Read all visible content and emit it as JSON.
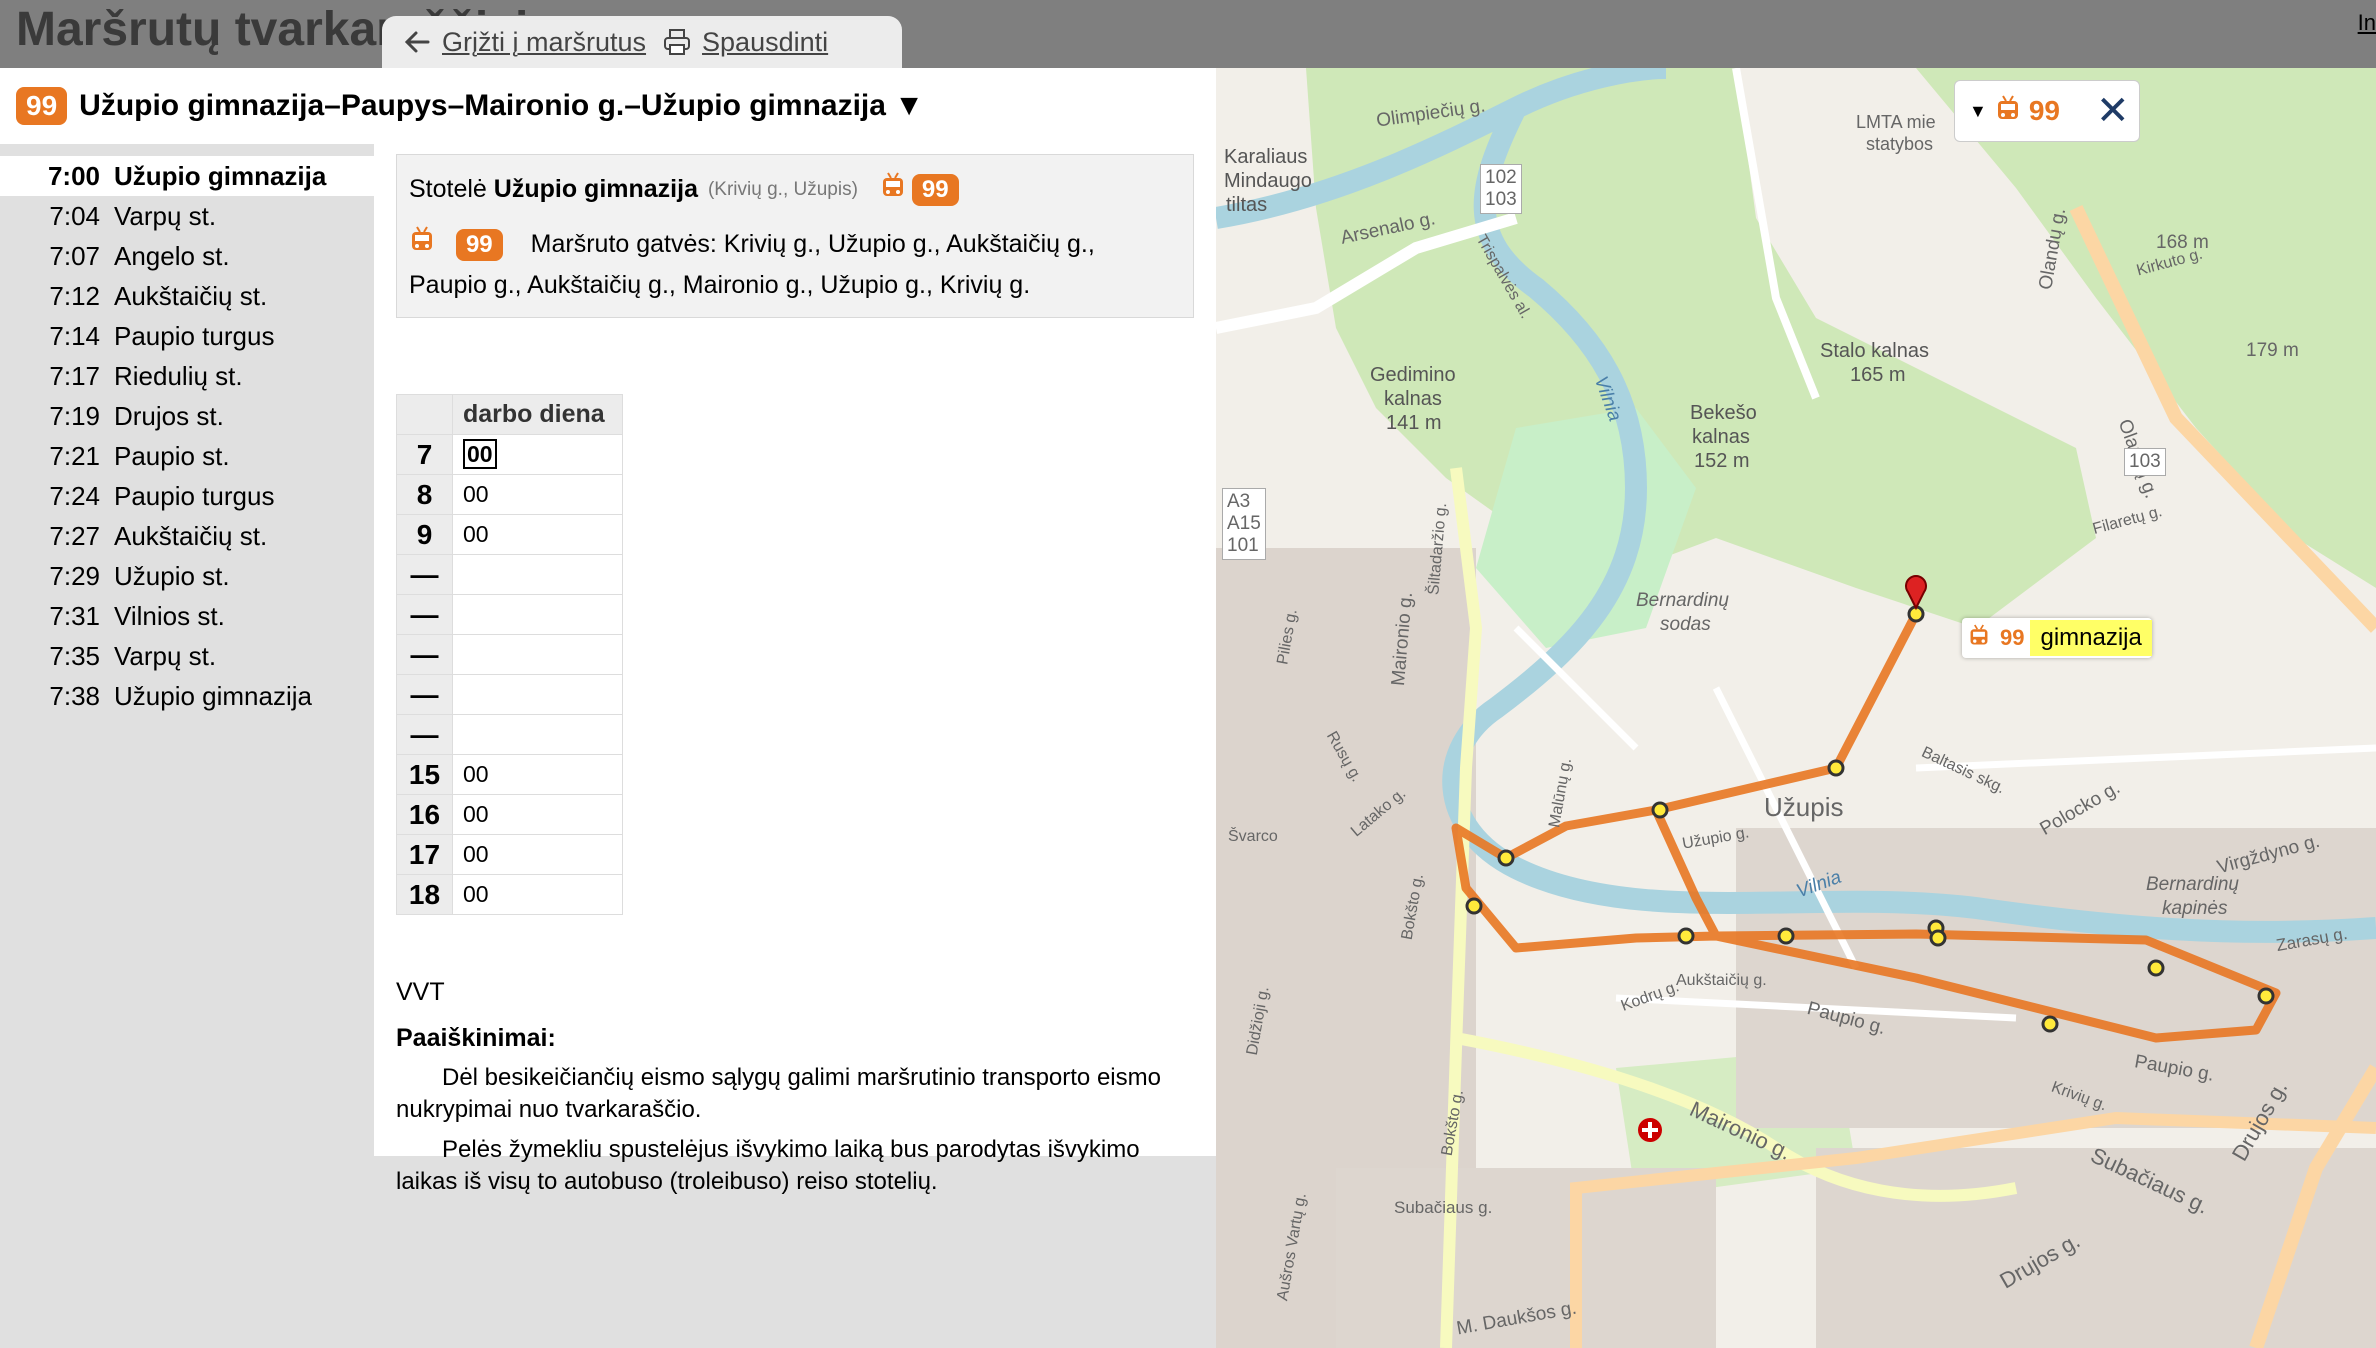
{
  "app": {
    "title": "Maršrutų tvarkaraščiai",
    "corner_link": "In"
  },
  "toolbar": {
    "back_label": "Grįžti į maršrutus",
    "print_label": "Spausdinti"
  },
  "route": {
    "number": "99",
    "title": "Užupio gimnazija–Paupys–Maironio g.–Užupio gimnazija ▼",
    "color": "#e87722"
  },
  "stops": [
    {
      "time": "7:00",
      "name": "Užupio gimnazija",
      "selected": true
    },
    {
      "time": "7:04",
      "name": "Varpų st."
    },
    {
      "time": "7:07",
      "name": "Angelo st."
    },
    {
      "time": "7:12",
      "name": "Aukštaičių st."
    },
    {
      "time": "7:14",
      "name": "Paupio turgus"
    },
    {
      "time": "7:17",
      "name": "Riedulių st."
    },
    {
      "time": "7:19",
      "name": "Drujos st."
    },
    {
      "time": "7:21",
      "name": "Paupio st."
    },
    {
      "time": "7:24",
      "name": "Paupio turgus"
    },
    {
      "time": "7:27",
      "name": "Aukštaičių st."
    },
    {
      "time": "7:29",
      "name": "Užupio st."
    },
    {
      "time": "7:31",
      "name": "Vilnios st."
    },
    {
      "time": "7:35",
      "name": "Varpų st."
    },
    {
      "time": "7:38",
      "name": "Užupio gimnazija"
    }
  ],
  "stop_info": {
    "prefix": "Stotelė",
    "name": "Užupio gimnazija",
    "details": "(Krivių g., Užupis)",
    "route_number": "99",
    "streets": "Maršruto gatvės: Krivių g., Užupio g., Aukštaičių g., Paupio g., Aukštaičių g., Maironio g., Užupio g., Krivių g."
  },
  "timetable": {
    "header": "darbo diena",
    "rows": [
      {
        "hour": "7",
        "minutes": "00",
        "selected": true
      },
      {
        "hour": "8",
        "minutes": "00"
      },
      {
        "hour": "9",
        "minutes": "00"
      },
      {
        "hour": "—",
        "minutes": ""
      },
      {
        "hour": "—",
        "minutes": ""
      },
      {
        "hour": "—",
        "minutes": ""
      },
      {
        "hour": "—",
        "minutes": ""
      },
      {
        "hour": "—",
        "minutes": ""
      },
      {
        "hour": "15",
        "minutes": "00"
      },
      {
        "hour": "16",
        "minutes": "00"
      },
      {
        "hour": "17",
        "minutes": "00"
      },
      {
        "hour": "18",
        "minutes": "00"
      }
    ]
  },
  "operator": "VVT",
  "explanations": {
    "heading": "Paaiškinimai:",
    "p1": "Dėl besikeičiančių eismo sąlygų galimi maršrutinio transporto eismo nukrypimai nuo tvarkaraščio.",
    "p2": "Pelės žymekliu spustelėjus išvykimo laiką bus parodytas išvykimo laikas iš visų to autobuso (troleibuso) reiso stotelių."
  },
  "map": {
    "control_route": "99",
    "tooltip_route": "99",
    "tooltip_name": "gimnazija",
    "labels": {
      "olimpieciu": "Olimpiečių g.",
      "karaliaus": "Karaliaus",
      "mindaugo": "Mindaugo",
      "tiltas": "tiltas",
      "arsenalo": "Arsenalo g.",
      "lmta1": "LMTA mie",
      "lmta2": "statybos",
      "gediminas1": "Gedimino",
      "gediminas2": "kalnas",
      "gediminas3": "141 m",
      "stalo1": "Stalo kalnas",
      "stalo2": "165 m",
      "bekeso1": "Bekešo",
      "bekeso2": "kalnas",
      "bekeso3": "152 m",
      "bernardinu1": "Bernardinų",
      "bernardinu2": "sodas",
      "vilnia1": "Vilnia",
      "vilnia2": "Vilnia",
      "uzupis": "Užupis",
      "maironio": "Maironio g.",
      "maironio2": "Maironio g.",
      "subaciaus": "Subačiaus g.",
      "subaciaus2": "Subačiaus g.",
      "drujos": "Drujos g.",
      "drujos2": "Drujos g.",
      "dauksos": "M. Daukšos g.",
      "paupio": "Paupio g.",
      "paupio2": "Paupio g.",
      "aukstaiciu": "Aukštaičių g.",
      "polocko": "Polocko g.",
      "virgzdyno": "Virgždyno g.",
      "zarasu": "Zarasų g.",
      "bernardinu_kapines1": "Bernardinų",
      "bernardinu_kapines2": "kapinės",
      "olandu": "Olandų g.",
      "olandu2": "Olandų g.",
      "kirkuto": "Kirkuto g.",
      "filaretu": "Filaretų g.",
      "baltasis": "Baltasis skg.",
      "m168": "168 m",
      "m179": "179 m",
      "road102_103": "102\n103",
      "road103": "103",
      "a3": "A3\nA15\n101",
      "pilies": "Pilies g.",
      "latako": "Latako g.",
      "boksto": "Bokšto g.",
      "boksto2": "Bokšto g.",
      "svarco": "Švarco",
      "malunu": "Malūnų g.",
      "krivuliai": "Krivių g.",
      "kodru": "Kodrų g.",
      "rusu": "Rusų g.",
      "ausros": "Aušros Vartų g.",
      "didzioji": "Didžioji g.",
      "siltadarzio": "Šiltadaržio g.",
      "trispalves": "Trispalvės al.",
      "uzupio_st": "Užupio g."
    }
  }
}
